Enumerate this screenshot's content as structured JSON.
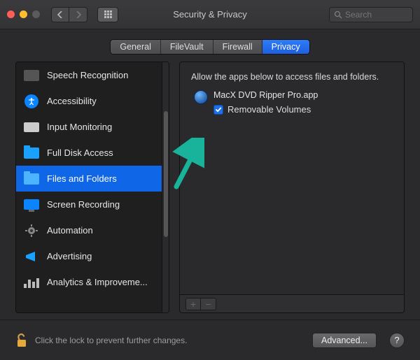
{
  "window": {
    "title": "Security & Privacy"
  },
  "search": {
    "placeholder": "Search"
  },
  "tabs": [
    {
      "label": "General"
    },
    {
      "label": "FileVault"
    },
    {
      "label": "Firewall"
    },
    {
      "label": "Privacy",
      "active": true
    }
  ],
  "sidebar": {
    "items": [
      {
        "label": "Speech Recognition",
        "icon": "waveform-icon"
      },
      {
        "label": "Accessibility",
        "icon": "accessibility-icon"
      },
      {
        "label": "Input Monitoring",
        "icon": "keyboard-icon"
      },
      {
        "label": "Full Disk Access",
        "icon": "folder-icon"
      },
      {
        "label": "Files and Folders",
        "icon": "folder-icon",
        "selected": true
      },
      {
        "label": "Screen Recording",
        "icon": "display-icon"
      },
      {
        "label": "Automation",
        "icon": "gear-icon"
      },
      {
        "label": "Advertising",
        "icon": "megaphone-icon"
      },
      {
        "label": "Analytics & Improveme...",
        "icon": "barchart-icon"
      }
    ]
  },
  "detail": {
    "header": "Allow the apps below to access files and folders.",
    "app": {
      "name": "MacX DVD Ripper Pro.app"
    },
    "permission": {
      "label": "Removable Volumes",
      "checked": true
    }
  },
  "footer": {
    "lock_text": "Click the lock to prevent further changes.",
    "advanced_label": "Advanced...",
    "help_label": "?"
  }
}
